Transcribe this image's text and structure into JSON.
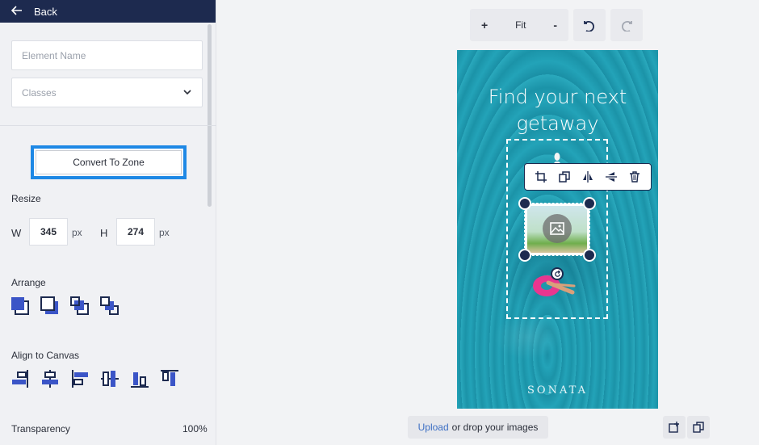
{
  "panel": {
    "back_label": "Back",
    "element_name_placeholder": "Element Name",
    "classes_placeholder": "Classes",
    "convert_label": "Convert To Zone",
    "resize_label": "Resize",
    "width_label": "W",
    "width_value": "345",
    "height_label": "H",
    "height_value": "274",
    "unit": "px",
    "arrange_label": "Arrange",
    "arrange_icons": [
      "bring-to-front-icon",
      "send-to-back-icon",
      "bring-forward-icon",
      "send-backward-icon"
    ],
    "align_label": "Align to Canvas",
    "align_icons": [
      "align-right-icon",
      "align-center-horizontal-icon",
      "align-left-icon",
      "align-middle-vertical-icon",
      "align-bottom-icon",
      "align-top-icon"
    ],
    "transparency_label": "Transparency",
    "transparency_value": "100%"
  },
  "toolbar": {
    "zoom_in": "+",
    "fit": "Fit",
    "zoom_out": "-",
    "undo_icon": "undo-icon",
    "redo_icon": "redo-icon"
  },
  "canvas": {
    "title_line1": "Find your next",
    "title_line2": "getaway",
    "brand": "SONATA",
    "element_toolbar": [
      "crop-icon",
      "duplicate-icon",
      "flip-horizontal-icon",
      "flip-vertical-icon",
      "trash-icon"
    ]
  },
  "bottom": {
    "upload_link": "Upload",
    "upload_text": "or drop your images"
  },
  "colors": {
    "nav": "#1d2a4f",
    "accent": "#1e88e5",
    "icon_blue": "#3b55c7",
    "link": "#3d6fc4"
  }
}
